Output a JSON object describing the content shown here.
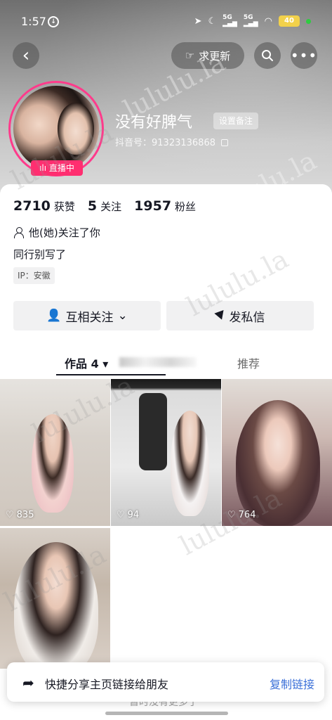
{
  "status_bar": {
    "time": "1:57",
    "network_icon": "signal-5g-icon",
    "battery": "40"
  },
  "nav": {
    "back_icon": "chevron-left-icon",
    "update_label": "求更新",
    "search_icon": "search-icon",
    "more_icon": "more-dots-icon"
  },
  "profile": {
    "name": "没有好脾气",
    "remark_label": "设置备注",
    "douyin_id": "抖音号：91323136868",
    "live_label": "直播中"
  },
  "stats": [
    {
      "num": "2710",
      "label": "获赞"
    },
    {
      "num": "5",
      "label": "关注"
    },
    {
      "num": "1957",
      "label": "粉丝"
    }
  ],
  "follow_note": "他(她)关注了你",
  "bio": "同行别写了",
  "ip": "IP：安徽",
  "actions": {
    "mutual": "互相关注",
    "message": "发私信"
  },
  "tabs": {
    "works": "作品 4",
    "recommend": "推荐"
  },
  "videos": [
    {
      "likes": "835"
    },
    {
      "likes": "94"
    },
    {
      "likes": "764"
    },
    {
      "likes": ""
    }
  ],
  "share": {
    "text": "快捷分享主页链接给朋友",
    "action": "复制链接"
  },
  "watermark": "lululu.la"
}
